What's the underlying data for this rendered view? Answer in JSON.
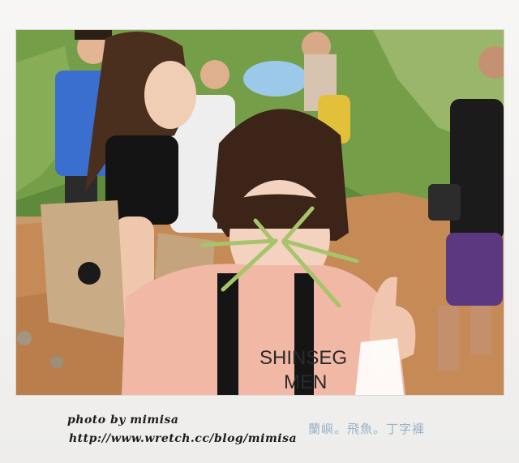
{
  "photo": {
    "description_icon": "photo-icon",
    "shirt_text": "SHINSEG\nMEN"
  },
  "credit": {
    "line1": "photo by mimisa",
    "line2": "http://www.wretch.cc/blog/mimisa"
  },
  "caption": "蘭嶼。飛魚。丁字褲",
  "colors": {
    "frame": "#f4f3f1",
    "caption": "#9ab2c7",
    "credit": "#1c1c1c"
  }
}
